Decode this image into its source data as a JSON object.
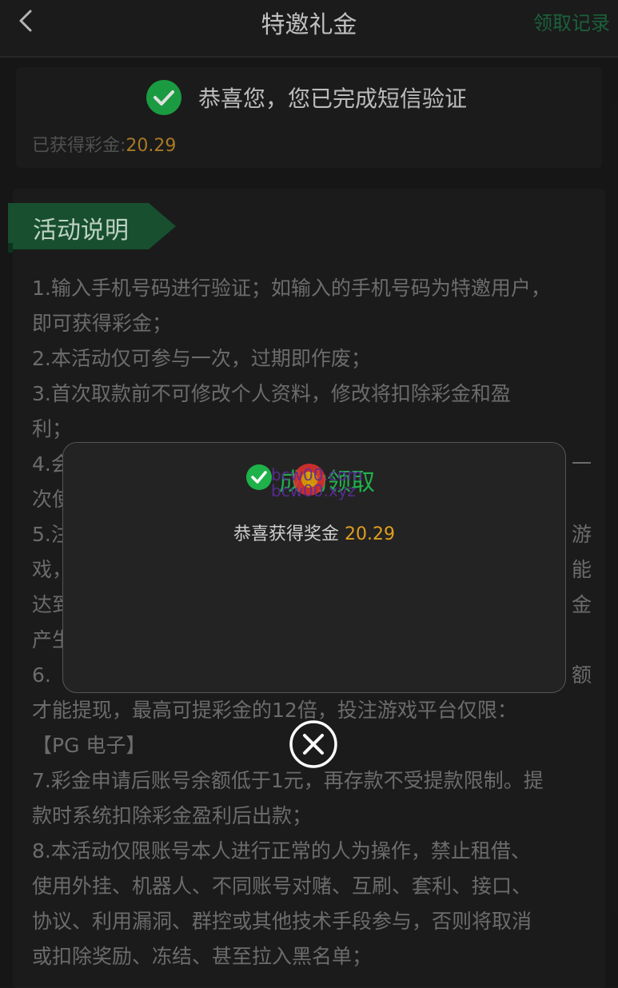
{
  "header": {
    "title": "特邀礼金",
    "records_link": "领取记录",
    "back_icon": "chevron-left-icon"
  },
  "verify_card": {
    "status_text": "恭喜您，您已完成短信验证",
    "bonus_label": "已获得彩金:",
    "bonus_value": "20.29",
    "check_color": "#1fb14a"
  },
  "rules_card": {
    "ribbon_title": "活动说明",
    "lines": [
      "1.输入手机号码进行验证；如输入的手机号码为特邀用户，",
      "即可获得彩金；",
      "2.本活动仅可参与一次，过期即作废；",
      "3.首次取款前不可修改个人资料，修改将扣除彩金和盈",
      "利；",
      "4.会",
      "次使",
      "5.注",
      "戏，",
      "达到",
      "产生",
      "6. ",
      "才能提现，最高可提彩金的12倍，投注游戏平台仅限：",
      "【PG 电子】",
      "7.彩金申请后账号余额低于1元，再存款不受提款限制。提",
      "款时系统扣除彩金盈利后出款；",
      "8.本活动仅限账号本人进行正常的人为操作，禁止租借、",
      "使用外挂、机器人、不同账号对赌、互刷、套利、接口、",
      "协议、利用漏洞、群控或其他技术手段参与，否则将取消",
      "或扣除奖励、冻结、甚至拉入黑名单；"
    ],
    "line_ends": {
      "4": "一",
      "7": "游",
      "8": "能",
      "9": "金",
      "11": "额"
    }
  },
  "modal": {
    "title": "成功领取",
    "message_prefix": "恭喜获得奖金 ",
    "amount": "20.29",
    "watermark_line1": "bcw00.com",
    "watermark_line2": "bcw00.xyz",
    "close_icon": "close-circle-icon"
  }
}
